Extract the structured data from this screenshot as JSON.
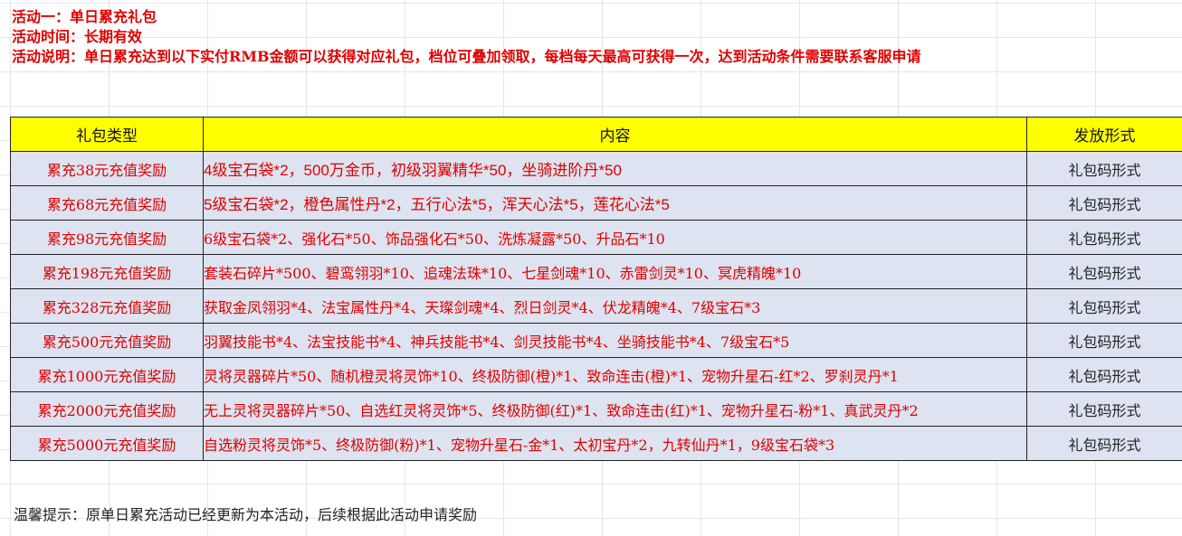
{
  "header": {
    "line1": "活动一：单日累充礼包",
    "line2": "活动时间：长期有效",
    "line3": "活动说明：单日累充达到以下实付RMB金额可以获得对应礼包，档位可叠加领取，每档每天最高可获得一次，达到活动条件需要联系客服申请"
  },
  "table": {
    "columns": [
      "礼包类型",
      "内容",
      "发放形式"
    ],
    "rows": [
      {
        "type": "累充38元充值奖励",
        "content": "4级宝石袋*2，500万金币，初级羽翼精华*50，坐骑进阶丹*50",
        "form": "礼包码形式"
      },
      {
        "type": "累充68元充值奖励",
        "content": "5级宝石袋*2，橙色属性丹*2，五行心法*5，浑天心法*5，莲花心法*5",
        "form": "礼包码形式"
      },
      {
        "type": "累充98元充值奖励",
        "content": "6级宝石袋*2、强化石*50、饰品强化石*50、洗炼凝露*50、升品石*10",
        "form": "礼包码形式"
      },
      {
        "type": "累充198元充值奖励",
        "content": "套装石碎片*500、碧鸾翎羽*10、追魂法珠*10、七星剑魂*10、赤雷剑灵*10、冥虎精魄*10",
        "form": "礼包码形式"
      },
      {
        "type": "累充328元充值奖励",
        "content": "获取金凤翎羽*4、法宝属性丹*4、天璨剑魂*4、烈日剑灵*4、伏龙精魄*4、7级宝石*3",
        "form": "礼包码形式"
      },
      {
        "type": "累充500元充值奖励",
        "content": "羽翼技能书*4、法宝技能书*4、神兵技能书*4、剑灵技能书*4、坐骑技能书*4、7级宝石*5",
        "form": "礼包码形式"
      },
      {
        "type": "累充1000元充值奖励",
        "content": "灵将灵器碎片*50、随机橙灵将灵饰*10、终极防御(橙)*1、致命连击(橙)*1、宠物升星石-红*2、罗刹灵丹*1",
        "form": "礼包码形式"
      },
      {
        "type": "累充2000元充值奖励",
        "content": "无上灵将灵器碎片*50、自选红灵将灵饰*5、终极防御(红)*1、致命连击(红)*1、宠物升星石-粉*1、真武灵丹*2",
        "form": "礼包码形式"
      },
      {
        "type": "累充5000元充值奖励",
        "content": "自选粉灵将灵饰*5、终极防御(粉)*1、宠物升星石-金*1、太初宝丹*2，九转仙丹*1，9级宝石袋*3",
        "form": "礼包码形式"
      }
    ]
  },
  "footer": {
    "tip": "温馨提示：原单日累充活动已经更新为本活动，后续根据此活动申请奖励"
  },
  "colors": {
    "header_text": "#e00000",
    "header_row_bg": "#ffff00",
    "row_bg": "#dde3f0",
    "content_text": "#e00000"
  }
}
